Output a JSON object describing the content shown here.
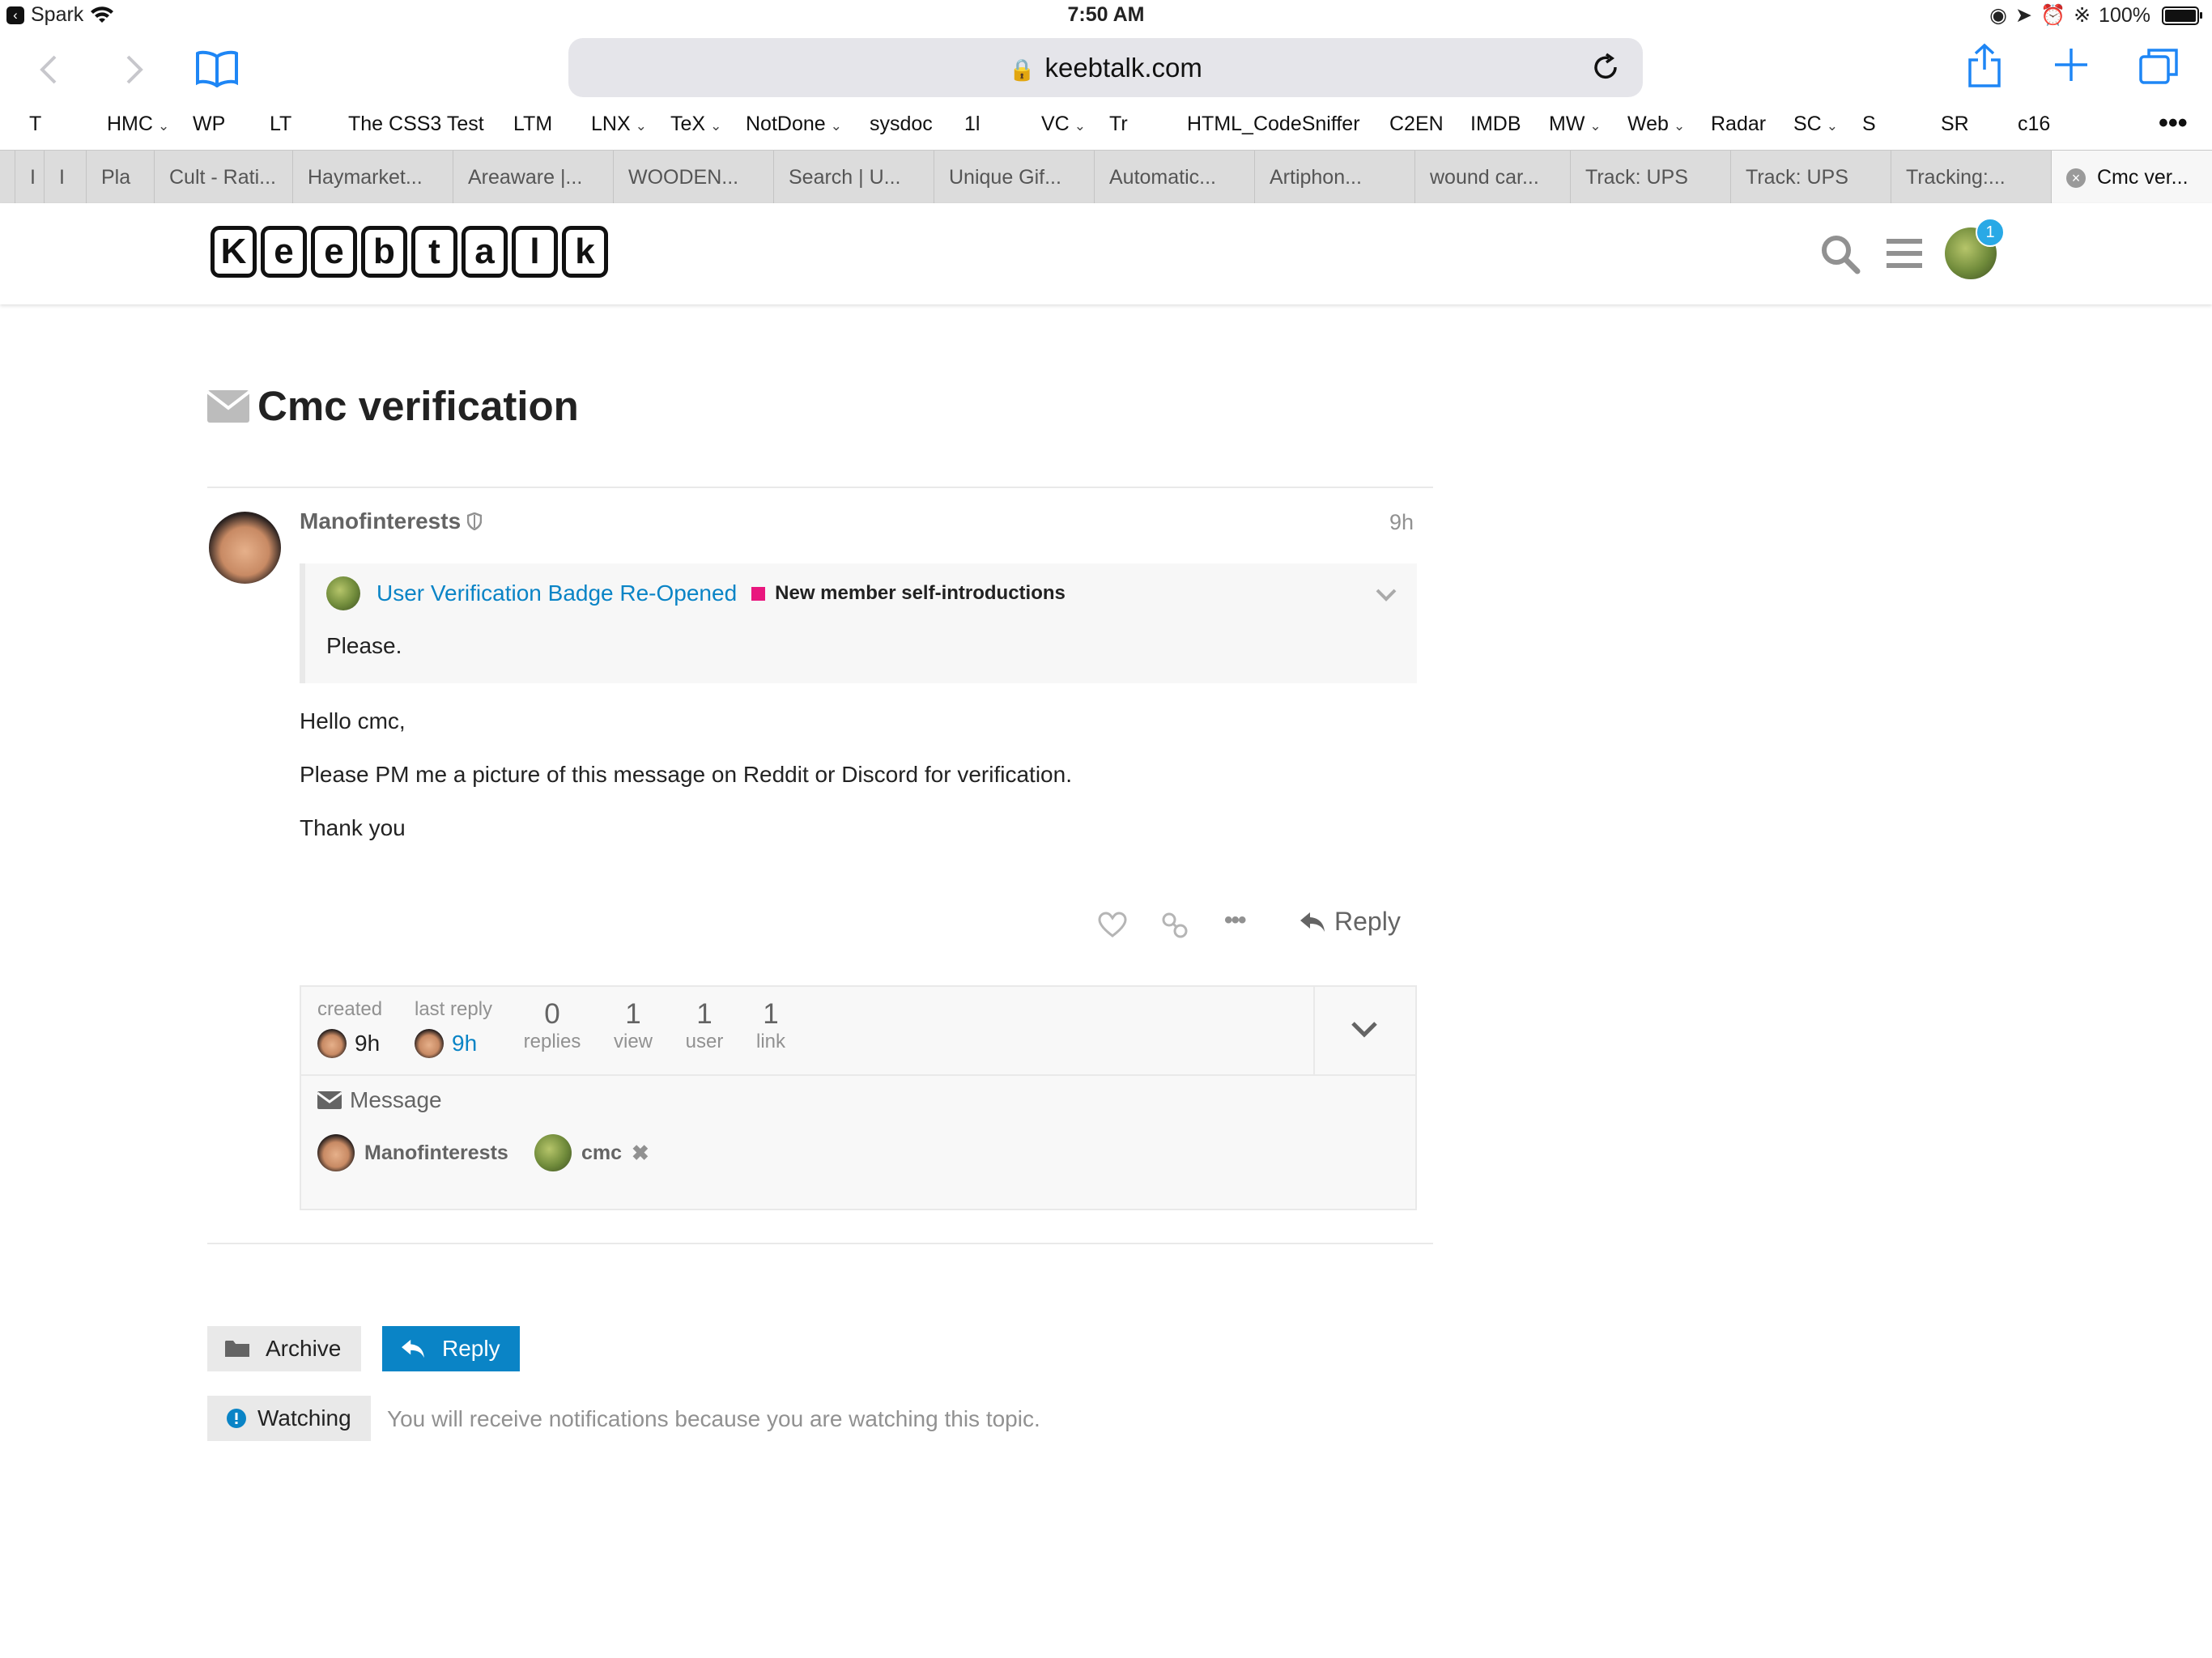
{
  "status_bar": {
    "back_app": "Spark",
    "time": "7:50 AM",
    "battery": "100%"
  },
  "browser": {
    "url": "keebtalk.com"
  },
  "bookmarks": [
    {
      "label": "T",
      "has_menu": false
    },
    {
      "label": "HMC",
      "has_menu": true
    },
    {
      "label": "WP",
      "has_menu": false
    },
    {
      "label": "LT",
      "has_menu": false
    },
    {
      "label": "The CSS3 Test",
      "has_menu": false
    },
    {
      "label": "LTM",
      "has_menu": false
    },
    {
      "label": "LNX",
      "has_menu": true
    },
    {
      "label": "TeX",
      "has_menu": true
    },
    {
      "label": "NotDone",
      "has_menu": true
    },
    {
      "label": "sysdoc",
      "has_menu": false
    },
    {
      "label": "1l",
      "has_menu": false
    },
    {
      "label": "VC",
      "has_menu": true
    },
    {
      "label": "Tr",
      "has_menu": false
    },
    {
      "label": "HTML_CodeSniffer",
      "has_menu": false
    },
    {
      "label": "C2EN",
      "has_menu": false
    },
    {
      "label": "IMDB",
      "has_menu": false
    },
    {
      "label": "MW",
      "has_menu": true
    },
    {
      "label": "Web",
      "has_menu": true
    },
    {
      "label": "Radar",
      "has_menu": false
    },
    {
      "label": "SC",
      "has_menu": true
    },
    {
      "label": "S",
      "has_menu": false
    },
    {
      "label": "SR",
      "has_menu": false
    },
    {
      "label": "c16",
      "has_menu": false
    }
  ],
  "tabs": [
    {
      "label": "I"
    },
    {
      "label": "Pla"
    },
    {
      "label": "Cult - Rati..."
    },
    {
      "label": "Haymarket..."
    },
    {
      "label": "Areaware |..."
    },
    {
      "label": "WOODEN..."
    },
    {
      "label": "Search | U..."
    },
    {
      "label": "Unique Gif..."
    },
    {
      "label": "Automatic..."
    },
    {
      "label": "Artiphon..."
    },
    {
      "label": "wound car..."
    },
    {
      "label": "Track: UPS"
    },
    {
      "label": "Track: UPS"
    },
    {
      "label": "Tracking:..."
    },
    {
      "label": "Cmc ver..."
    }
  ],
  "site": {
    "logo_letters": [
      "K",
      "e",
      "e",
      "b",
      "t",
      "a",
      "l",
      "k"
    ],
    "notification_count": "1"
  },
  "topic": {
    "title": "Cmc verification"
  },
  "post": {
    "username": "Manofinterests",
    "age": "9h",
    "quote": {
      "title": "User Verification Badge Re-Opened",
      "category": "New member self-introductions",
      "category_color": "#e9177e",
      "text": "Please."
    },
    "paragraphs": [
      "Hello cmc,",
      "Please PM me a picture of this message on Reddit or Discord for verification.",
      "Thank you"
    ],
    "reply_label": "Reply"
  },
  "topic_map": {
    "created_label": "created",
    "created_value": "9h",
    "last_reply_label": "last reply",
    "last_reply_value": "9h",
    "stats": [
      {
        "value": "0",
        "label": "replies"
      },
      {
        "value": "1",
        "label": "view"
      },
      {
        "value": "1",
        "label": "user"
      },
      {
        "value": "1",
        "label": "link"
      }
    ],
    "message_label": "Message",
    "participants": [
      "Manofinterests",
      "cmc"
    ]
  },
  "footer": {
    "archive_label": "Archive",
    "reply_label": "Reply",
    "watching_label": "Watching",
    "watching_desc": "You will receive notifications because you are watching this topic."
  },
  "colors": {
    "accent": "#0a84c6",
    "safari_blue": "#1e86f5",
    "notification_badge": "#29a9e6"
  }
}
